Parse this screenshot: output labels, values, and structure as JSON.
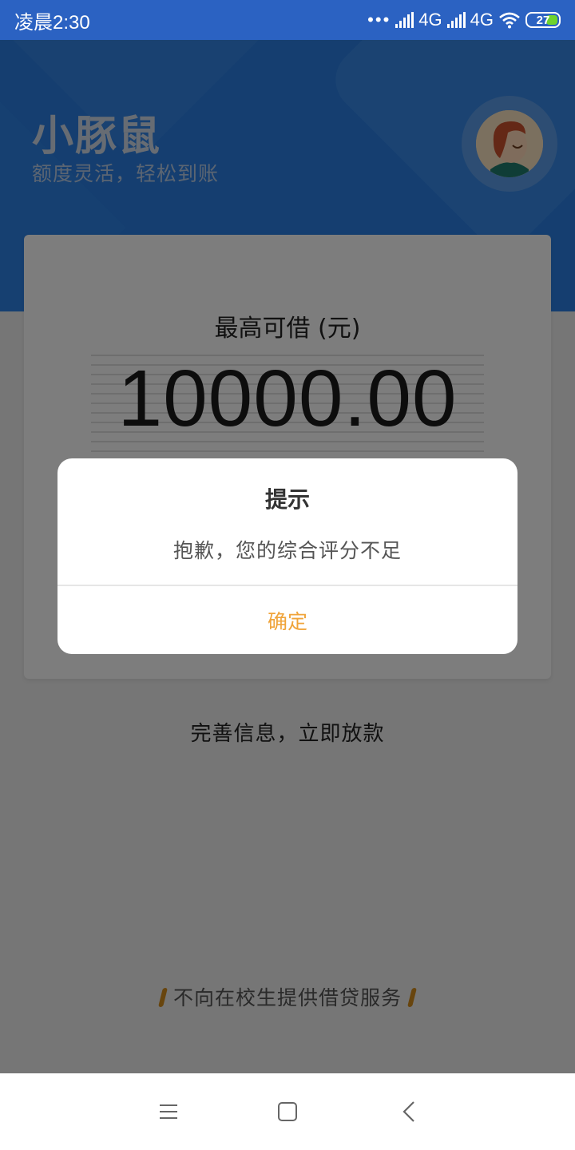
{
  "status_bar": {
    "time": "凌晨2:30",
    "dots": "•••",
    "network1": "4G",
    "network2": "4G",
    "battery": "27",
    "battery_color": "#6ed32d"
  },
  "header": {
    "app_name": "小豚鼠",
    "slogan": "额度灵活，轻松到账",
    "background_color": "#2a7de0"
  },
  "card": {
    "label": "最高可借 (元)",
    "amount": "10000.00"
  },
  "info_text": "完善信息，立即放款",
  "footer_note": "不向在校生提供借贷服务",
  "dialog": {
    "title": "提示",
    "message": "抱歉，您的综合评分不足",
    "confirm_label": "确定",
    "confirm_color": "#f0a43a"
  },
  "nav_bar": {
    "menu_icon": "menu-icon",
    "home_icon": "home-icon",
    "back_icon": "back-icon"
  }
}
